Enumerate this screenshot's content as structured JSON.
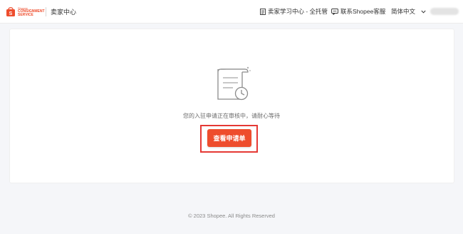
{
  "header": {
    "logo": {
      "line1": "Shopee",
      "line2": "CONSIGNMENT",
      "line3": "SERVICE"
    },
    "title": "卖家中心",
    "learning_center": "卖家学习中心 - 全托管",
    "contact": "联系Shopee客服",
    "language": "简体中文"
  },
  "main": {
    "status_message": "您的入驻申请正在审核中，请耐心等待",
    "view_application_button": "查看申请单"
  },
  "footer": {
    "copyright": "© 2023 Shopee. All Rights Reserved"
  },
  "colors": {
    "brand": "#ee4d2d",
    "highlight": "#e53935",
    "background": "#f5f6f9"
  }
}
